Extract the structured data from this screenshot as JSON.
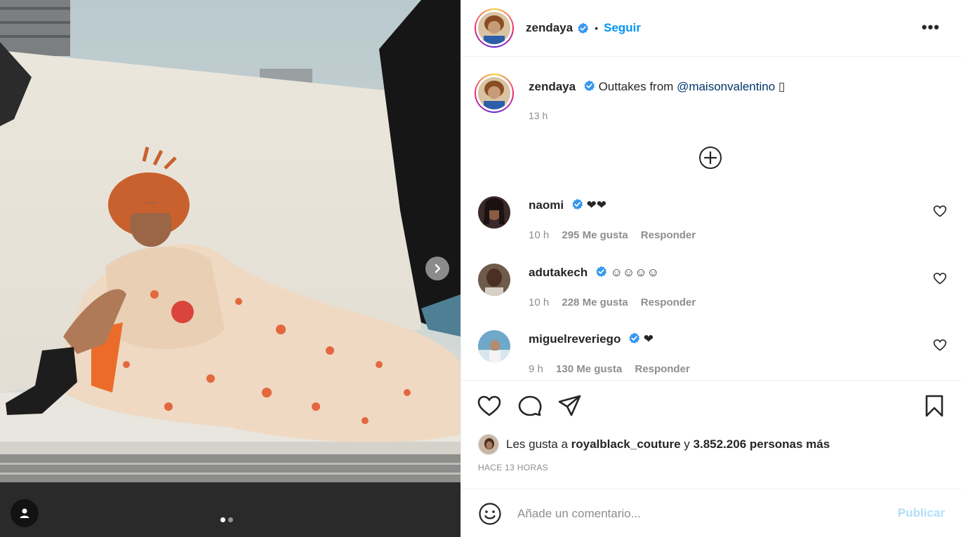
{
  "post": {
    "author": "zendaya",
    "follow_label": "Seguir",
    "separator": "•",
    "more_label": "•••",
    "caption_prefix": "Outtakes from",
    "caption_mention": "@maisonvalentino",
    "caption_suffix": "▯",
    "caption_time": "13 h"
  },
  "comments": [
    {
      "user": "naomi",
      "text": "❤❤",
      "time": "10 h",
      "likes": "295 Me gusta",
      "reply": "Responder",
      "verified": true
    },
    {
      "user": "adutakech",
      "text": "☺☺☺☺",
      "time": "10 h",
      "likes": "228 Me gusta",
      "reply": "Responder",
      "verified": true
    },
    {
      "user": "miguelreveriego",
      "text": "❤",
      "time": "9 h",
      "likes": "130 Me gusta",
      "reply": "Responder",
      "verified": true
    }
  ],
  "likes": {
    "prefix": "Les gusta a",
    "first_user": "royalblack_couture",
    "connector": "y",
    "others": "3.852.206 personas más"
  },
  "timestamp": "HACE 13 HORAS",
  "composer": {
    "placeholder": "Añade un comentario...",
    "publish_label": "Publicar"
  },
  "carousel": {
    "current": 1,
    "total": 2
  },
  "colors": {
    "accent": "#0095f6",
    "publish_disabled": "#b2dffc",
    "secondary_text": "#8e8e8e",
    "verified": "#3897f0"
  },
  "icons": [
    "verified-badge-icon",
    "more-options-icon",
    "load-more-comments-icon",
    "heart-icon",
    "comment-icon",
    "share-icon",
    "bookmark-icon",
    "emoji-icon",
    "chevron-right-icon",
    "user-tag-icon"
  ]
}
